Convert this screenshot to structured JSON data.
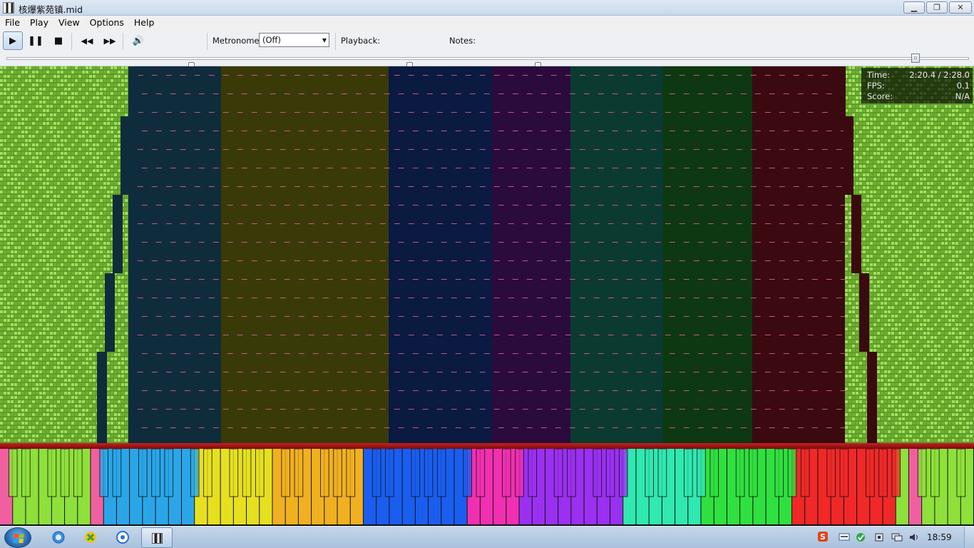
{
  "window": {
    "title": "核爆紫苑镇.mid",
    "minimize_glyph": "▁",
    "maximize_glyph": "❐",
    "close_glyph": "✕"
  },
  "menu": {
    "items": [
      "File",
      "Play",
      "View",
      "Options",
      "Help"
    ]
  },
  "toolbar": {
    "play_glyph": "▶",
    "pause_glyph": "❚❚",
    "stop_glyph": "■",
    "rewind_glyph": "◀◀",
    "ffwd_glyph": "▶▶",
    "volume_glyph": "🔊",
    "metronome_label": "Metronome:",
    "metronome_value": "(Off)",
    "playback_label": "Playback:",
    "notes_label": "Notes:",
    "volume_level": 0.9,
    "playback_level": 0.5,
    "notes_level": 1.0,
    "seek_position": 0.95
  },
  "stats": {
    "time_label": "Time:",
    "time_value": "2:20.4 / 2:28.0",
    "fps_label": "FPS:",
    "fps_value": "0.1",
    "score_label": "Score:",
    "score_value": "N/A"
  },
  "colors": {
    "track_colors": [
      "#8ee03a",
      "#2aa6e8",
      "#e6e020",
      "#f0b020",
      "#1a5ef0",
      "#f030b0",
      "#9a30f0",
      "#30e8b0",
      "#30e040",
      "#f02828",
      "#8ee03a",
      "#f060a0"
    ],
    "note_line": "#e0609a",
    "rail": "#c62020"
  },
  "taskbar": {
    "clock": "18:59",
    "pinned_icons": [
      "ie-icon",
      "media-icon",
      "network-icon"
    ],
    "tray_icons": [
      "sogou-icon",
      "keyboard-icon",
      "security-icon",
      "usb-icon",
      "network-tray-icon",
      "volume-tray-icon"
    ]
  }
}
